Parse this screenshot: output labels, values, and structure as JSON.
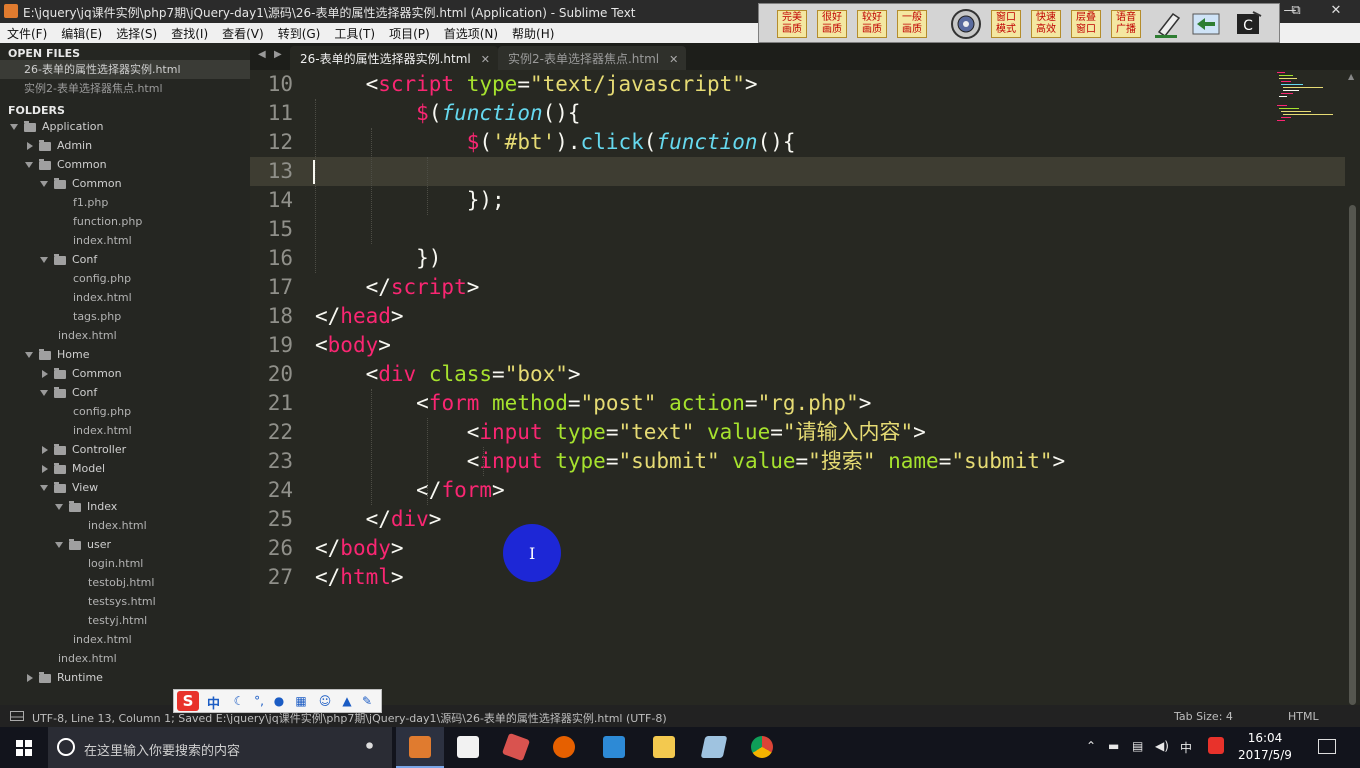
{
  "window": {
    "title": "E:\\jquery\\jq课件实例\\php7期\\jQuery-day1\\源码\\26-表单的属性选择器实例.html (Application) - Sublime Text",
    "minimize": "—",
    "restore": "⧉",
    "close": "✕"
  },
  "menu": [
    "文件(F)",
    "编辑(E)",
    "选择(S)",
    "查找(I)",
    "查看(V)",
    "转到(G)",
    "工具(T)",
    "项目(P)",
    "首选项(N)",
    "帮助(H)"
  ],
  "quality_toolbar": {
    "buttons": [
      {
        "line1": "完美",
        "line2": "画质"
      },
      {
        "line1": "很好",
        "line2": "画质"
      },
      {
        "line1": "较好",
        "line2": "画质"
      },
      {
        "line1": "一般",
        "line2": "画质"
      },
      {
        "line1": "窗口",
        "line2": "模式"
      },
      {
        "line1": "快速",
        "line2": "高效"
      },
      {
        "line1": "层叠",
        "line2": "窗口"
      },
      {
        "line1": "语音",
        "line2": "广播"
      }
    ]
  },
  "sidebar": {
    "open_files_header": "OPEN FILES",
    "open_files": [
      "26-表单的属性选择器实例.html",
      "实例2-表单选择器焦点.html"
    ],
    "folders_header": "FOLDERS",
    "tree": [
      {
        "label": "Application",
        "type": "folder",
        "level": 0,
        "open": true
      },
      {
        "label": "Admin",
        "type": "folder",
        "level": 1,
        "open": false
      },
      {
        "label": "Common",
        "type": "folder",
        "level": 1,
        "open": true
      },
      {
        "label": "Common",
        "type": "folder",
        "level": 2,
        "open": true
      },
      {
        "label": "f1.php",
        "type": "file",
        "level": 3
      },
      {
        "label": "function.php",
        "type": "file",
        "level": 3
      },
      {
        "label": "index.html",
        "type": "file",
        "level": 3
      },
      {
        "label": "Conf",
        "type": "folder",
        "level": 2,
        "open": true
      },
      {
        "label": "config.php",
        "type": "file",
        "level": 3
      },
      {
        "label": "index.html",
        "type": "file",
        "level": 3
      },
      {
        "label": "tags.php",
        "type": "file",
        "level": 3
      },
      {
        "label": "index.html",
        "type": "file",
        "level": 2
      },
      {
        "label": "Home",
        "type": "folder",
        "level": 1,
        "open": true
      },
      {
        "label": "Common",
        "type": "folder",
        "level": 2,
        "open": false
      },
      {
        "label": "Conf",
        "type": "folder",
        "level": 2,
        "open": true
      },
      {
        "label": "config.php",
        "type": "file",
        "level": 3
      },
      {
        "label": "index.html",
        "type": "file",
        "level": 3
      },
      {
        "label": "Controller",
        "type": "folder",
        "level": 2,
        "open": false
      },
      {
        "label": "Model",
        "type": "folder",
        "level": 2,
        "open": false
      },
      {
        "label": "View",
        "type": "folder",
        "level": 2,
        "open": true
      },
      {
        "label": "Index",
        "type": "folder",
        "level": 3,
        "open": true
      },
      {
        "label": "index.html",
        "type": "file",
        "level": 4
      },
      {
        "label": "user",
        "type": "folder",
        "level": 3,
        "open": true
      },
      {
        "label": "login.html",
        "type": "file",
        "level": 4
      },
      {
        "label": "testobj.html",
        "type": "file",
        "level": 4
      },
      {
        "label": "testsys.html",
        "type": "file",
        "level": 4
      },
      {
        "label": "testyj.html",
        "type": "file",
        "level": 4
      },
      {
        "label": "index.html",
        "type": "file",
        "level": 3
      },
      {
        "label": "index.html",
        "type": "file",
        "level": 2
      },
      {
        "label": "Runtime",
        "type": "folder",
        "level": 1,
        "open": false
      }
    ]
  },
  "tabs": [
    {
      "label": "26-表单的属性选择器实例.html",
      "active": true,
      "close": "✕"
    },
    {
      "label": "实例2-表单选择器焦点.html",
      "active": false,
      "close": "✕"
    }
  ],
  "tab_nav": {
    "prev": "◀",
    "next": "▶"
  },
  "editor": {
    "current_line": 13,
    "lines": [
      {
        "n": "10",
        "tokens": [
          [
            "p",
            "    <"
          ],
          [
            "t",
            "script"
          ],
          [
            "p",
            " "
          ],
          [
            "a",
            "type"
          ],
          [
            "p",
            "="
          ],
          [
            "s",
            "\"text/javascript\""
          ],
          [
            "p",
            ">"
          ]
        ]
      },
      {
        "n": "11",
        "tokens": [
          [
            "p",
            "        "
          ],
          [
            "d",
            "$"
          ],
          [
            "p",
            "("
          ],
          [
            "k",
            "function"
          ],
          [
            "p",
            "(){"
          ]
        ]
      },
      {
        "n": "12",
        "tokens": [
          [
            "p",
            "            "
          ],
          [
            "d",
            "$"
          ],
          [
            "p",
            "("
          ],
          [
            "s",
            "'#bt'"
          ],
          [
            "p",
            ")."
          ],
          [
            "f",
            "click"
          ],
          [
            "p",
            "("
          ],
          [
            "k",
            "function"
          ],
          [
            "p",
            "(){"
          ]
        ]
      },
      {
        "n": "13",
        "tokens": [
          [
            "p",
            ""
          ]
        ]
      },
      {
        "n": "14",
        "tokens": [
          [
            "p",
            "            });"
          ]
        ]
      },
      {
        "n": "15",
        "tokens": [
          [
            "p",
            ""
          ]
        ]
      },
      {
        "n": "16",
        "tokens": [
          [
            "p",
            "        })"
          ]
        ]
      },
      {
        "n": "17",
        "tokens": [
          [
            "p",
            "    </"
          ],
          [
            "t",
            "script"
          ],
          [
            "p",
            ">"
          ]
        ]
      },
      {
        "n": "18",
        "tokens": [
          [
            "p",
            "</"
          ],
          [
            "t",
            "head"
          ],
          [
            "p",
            ">"
          ]
        ]
      },
      {
        "n": "19",
        "tokens": [
          [
            "p",
            "<"
          ],
          [
            "t",
            "body"
          ],
          [
            "p",
            ">"
          ]
        ]
      },
      {
        "n": "20",
        "tokens": [
          [
            "p",
            "    <"
          ],
          [
            "t",
            "div"
          ],
          [
            "p",
            " "
          ],
          [
            "a",
            "class"
          ],
          [
            "p",
            "="
          ],
          [
            "s",
            "\"box\""
          ],
          [
            "p",
            ">"
          ]
        ]
      },
      {
        "n": "21",
        "tokens": [
          [
            "p",
            "        <"
          ],
          [
            "t",
            "form"
          ],
          [
            "p",
            " "
          ],
          [
            "a",
            "method"
          ],
          [
            "p",
            "="
          ],
          [
            "s",
            "\"post\""
          ],
          [
            "p",
            " "
          ],
          [
            "a",
            "action"
          ],
          [
            "p",
            "="
          ],
          [
            "s",
            "\"rg.php\""
          ],
          [
            "p",
            ">"
          ]
        ]
      },
      {
        "n": "22",
        "tokens": [
          [
            "p",
            "            <"
          ],
          [
            "t",
            "input"
          ],
          [
            "p",
            " "
          ],
          [
            "a",
            "type"
          ],
          [
            "p",
            "="
          ],
          [
            "s",
            "\"text\""
          ],
          [
            "p",
            " "
          ],
          [
            "a",
            "value"
          ],
          [
            "p",
            "="
          ],
          [
            "s",
            "\"请输入内容\""
          ],
          [
            "p",
            ">"
          ]
        ]
      },
      {
        "n": "23",
        "tokens": [
          [
            "p",
            "            <"
          ],
          [
            "t",
            "input"
          ],
          [
            "p",
            " "
          ],
          [
            "a",
            "type"
          ],
          [
            "p",
            "="
          ],
          [
            "s",
            "\"submit\""
          ],
          [
            "p",
            " "
          ],
          [
            "a",
            "value"
          ],
          [
            "p",
            "="
          ],
          [
            "s",
            "\"搜索\""
          ],
          [
            "p",
            " "
          ],
          [
            "a",
            "name"
          ],
          [
            "p",
            "="
          ],
          [
            "s",
            "\"submit\""
          ],
          [
            "p",
            ">"
          ]
        ]
      },
      {
        "n": "24",
        "tokens": [
          [
            "p",
            "        </"
          ],
          [
            "t",
            "form"
          ],
          [
            "p",
            ">"
          ]
        ]
      },
      {
        "n": "25",
        "tokens": [
          [
            "p",
            "    </"
          ],
          [
            "t",
            "div"
          ],
          [
            "p",
            ">"
          ]
        ]
      },
      {
        "n": "26",
        "tokens": [
          [
            "p",
            "</"
          ],
          [
            "t",
            "body"
          ],
          [
            "p",
            ">"
          ]
        ]
      },
      {
        "n": "27",
        "tokens": [
          [
            "p",
            "</"
          ],
          [
            "t",
            "html"
          ],
          [
            "p",
            ">"
          ]
        ]
      }
    ]
  },
  "statusbar": {
    "left": "UTF-8, Line 13, Column 1; Saved E:\\jquery\\jq课件实例\\php7期\\jQuery-day1\\源码\\26-表单的属性选择器实例.html (UTF-8)",
    "tab_size": "Tab Size: 4",
    "syntax": "HTML"
  },
  "ime": {
    "logo": "S",
    "mode": "中"
  },
  "mouse_cursor": "I",
  "taskbar": {
    "search_placeholder": "在这里输入你要搜索的内容",
    "tray_ime": "中",
    "time": "16:04",
    "date": "2017/5/9"
  },
  "colors": {
    "editor_bg": "#272822",
    "tag": "#f92672",
    "attr": "#a6e22e",
    "string": "#e6db74",
    "keyword": "#66d9ef",
    "click_highlight": "#1d27d6"
  }
}
